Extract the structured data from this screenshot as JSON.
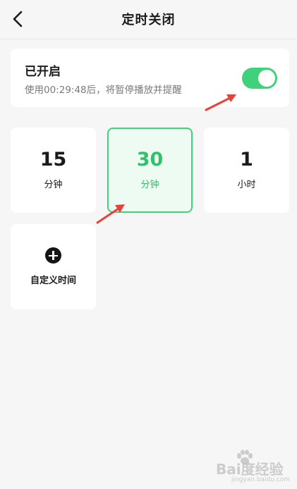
{
  "header": {
    "title": "定时关闭",
    "back_icon": "chevron-left-icon"
  },
  "status": {
    "label": "已开启",
    "description": "使用00:29:48后，将暂停播放并提醒",
    "toggle_on": true,
    "toggle_color": "#3fd27a"
  },
  "options": [
    {
      "value": "15",
      "unit": "分钟",
      "selected": false
    },
    {
      "value": "30",
      "unit": "分钟",
      "selected": true
    },
    {
      "value": "1",
      "unit": "小时",
      "selected": false
    }
  ],
  "custom": {
    "icon": "plus-circle-icon",
    "label": "自定义时间"
  },
  "watermark": {
    "text": "Bai度经验",
    "sub": "jingyan.baidu.com"
  },
  "colors": {
    "accent": "#3fd27a",
    "annotation_arrow": "#e8413a"
  }
}
